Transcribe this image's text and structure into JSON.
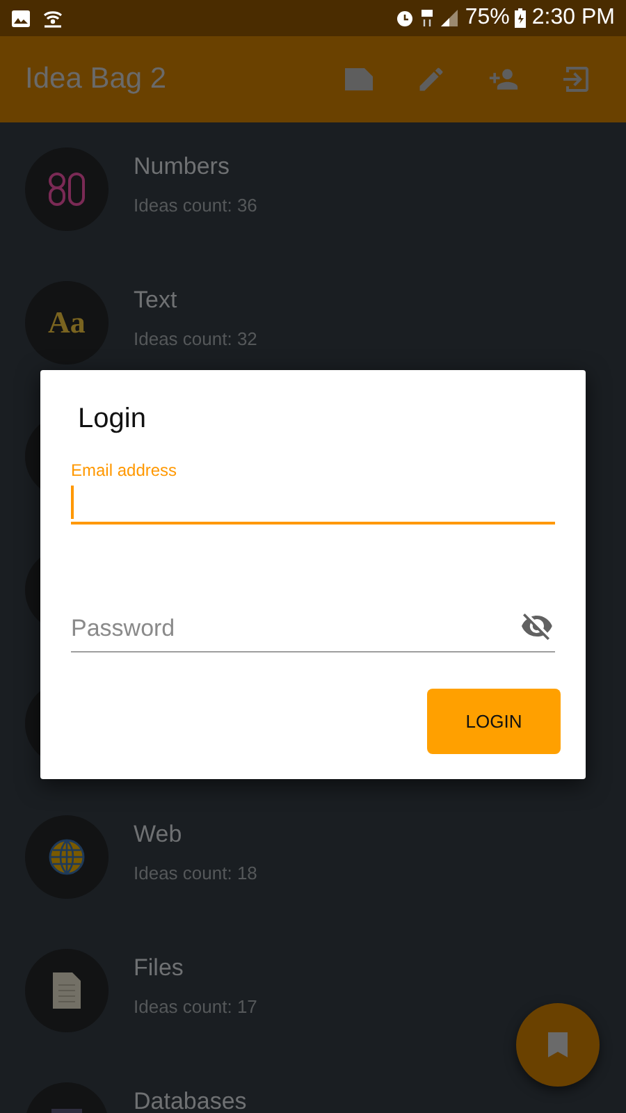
{
  "status_bar": {
    "battery": "75%",
    "time": "2:30 PM"
  },
  "app_bar": {
    "title": "Idea Bag 2",
    "actions": [
      {
        "kind": "label"
      },
      {
        "kind": "edit"
      },
      {
        "kind": "add-person"
      },
      {
        "kind": "login"
      }
    ]
  },
  "categories": [
    {
      "title": "Numbers",
      "count": "Ideas count: 36",
      "kind": "numbers"
    },
    {
      "title": "Text",
      "count": "Ideas count: 32",
      "kind": "letters",
      "icon_text": "Aa"
    },
    {
      "kind": "blank"
    },
    {
      "kind": "blank"
    },
    {
      "kind": "blank"
    },
    {
      "title": "Web",
      "count": "Ideas count: 18",
      "kind": "globe"
    },
    {
      "title": "Files",
      "count": "Ideas count: 17",
      "kind": "file"
    },
    {
      "title": "Databases",
      "kind": "database"
    }
  ],
  "dialog": {
    "title": "Login",
    "fields": [
      {
        "kind": "email",
        "label": "Email address",
        "focused": true
      },
      {
        "kind": "password",
        "placeholder": "Password",
        "focused": false
      }
    ],
    "button": "LOGIN"
  },
  "fab": {
    "kind": "bookmark"
  }
}
